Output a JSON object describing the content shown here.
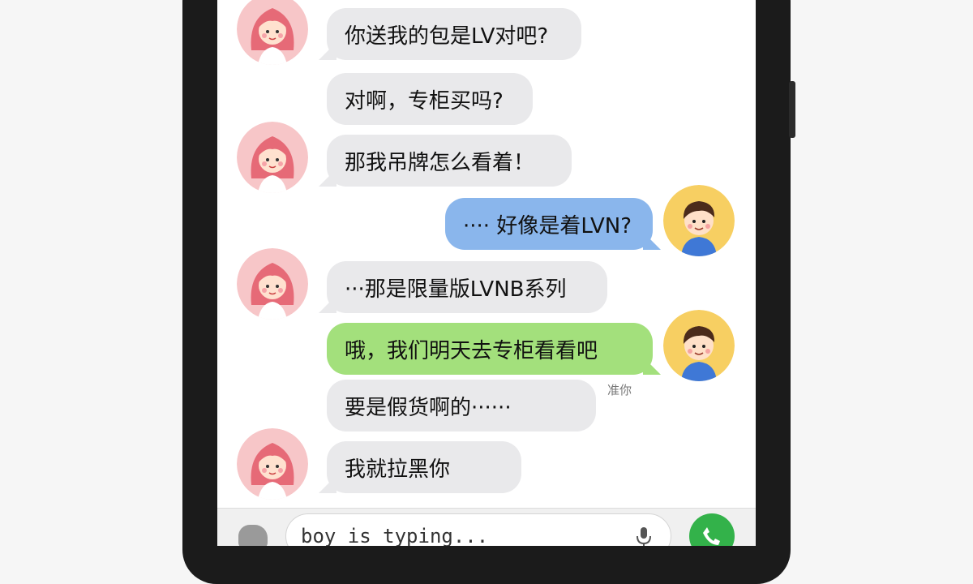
{
  "chat": {
    "messages": [
      {
        "sender": "girl",
        "text": "你送我的包是LV对吧?"
      },
      {
        "sender": "girl",
        "text": "对啊，专柜买吗?"
      },
      {
        "sender": "girl",
        "text": "那我吊牌怎么看着！"
      },
      {
        "sender": "boy",
        "text": "···· 好像是着LVN?"
      },
      {
        "sender": "girl",
        "text": "···那是限量版LVNB系列"
      },
      {
        "sender": "boy",
        "text": "哦，我们明天去专柜看看吧"
      },
      {
        "sender": "girl",
        "text": "要是假货啊的······"
      },
      {
        "sender": "girl",
        "text": "我就拉黑你"
      }
    ],
    "time_note": "准你"
  },
  "input_bar": {
    "text": "boy is typing..."
  },
  "icons": {
    "camera": "camera-icon",
    "mic": "mic-icon",
    "call": "phone-icon"
  },
  "colors": {
    "grey_bubble": "#e9e9eb",
    "blue_bubble": "#8ab6ec",
    "green_bubble": "#a3e07c",
    "call_button": "#33b24a"
  }
}
